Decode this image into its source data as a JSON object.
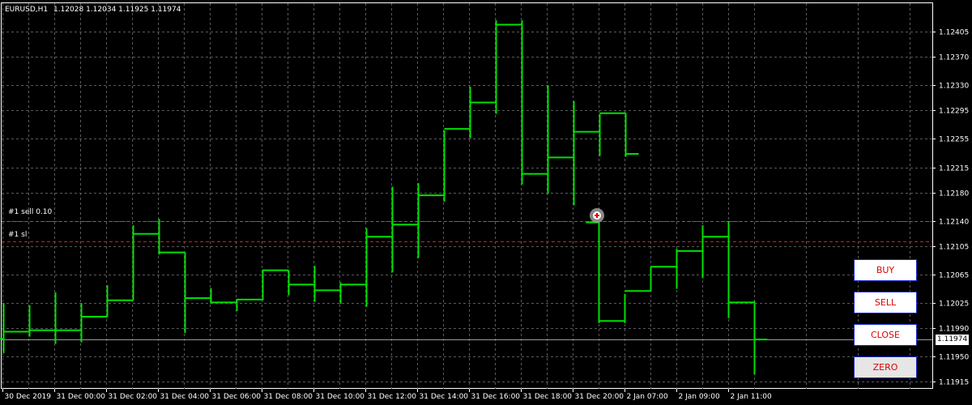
{
  "header": {
    "symbol": "EURUSD,H1",
    "ohlc": "1.12028 1.12034 1.11925 1.11974"
  },
  "order_lines": {
    "sell_label": "#1 sell 0.10",
    "sl_label": "#1 sl",
    "sell_color": "#00b000",
    "sl_color": "#d02020"
  },
  "current_price": "1.11974",
  "buttons": {
    "buy": "BUY",
    "sell": "SELL",
    "close": "CLOSE",
    "zero": "ZERO"
  },
  "colors": {
    "background": "#000000",
    "grid": "#5a5a5a",
    "bars": "#00e000",
    "axis_text": "#ffffff",
    "button_text": "#e00000",
    "button_border": "#1a2bd0"
  },
  "chart_data": {
    "type": "ohlc",
    "price_ticks": [
      "1.12405",
      "1.12370",
      "1.12330",
      "1.12295",
      "1.12255",
      "1.12215",
      "1.12180",
      "1.12140",
      "1.12105",
      "1.12065",
      "1.12025",
      "1.11990",
      "1.11950",
      "1.11915"
    ],
    "time_ticks": [
      "30 Dec 2019",
      "31 Dec 00:00",
      "31 Dec 02:00",
      "31 Dec 04:00",
      "31 Dec 06:00",
      "31 Dec 08:00",
      "31 Dec 10:00",
      "31 Dec 12:00",
      "31 Dec 14:00",
      "31 Dec 16:00",
      "31 Dec 18:00",
      "31 Dec 20:00",
      "2 Jan 07:00",
      "2 Jan 09:00",
      "2 Jan 11:00"
    ],
    "ylim": [
      1.11905,
      1.12445
    ],
    "sell_level": 1.1214,
    "sl_level": 1.12111,
    "bars": [
      [
        1.11975,
        1.12025,
        1.11955,
        1.11985
      ],
      [
        1.11985,
        1.12022,
        1.11978,
        1.11987
      ],
      [
        1.11987,
        1.1204,
        1.11968,
        1.11987
      ],
      [
        1.11987,
        1.12025,
        1.1197,
        1.12006
      ],
      [
        1.12006,
        1.1205,
        1.12006,
        1.12029
      ],
      [
        1.12029,
        1.12134,
        1.12029,
        1.12122
      ],
      [
        1.12122,
        1.12143,
        1.12093,
        1.12096
      ],
      [
        1.12096,
        1.12096,
        1.11983,
        1.12032
      ],
      [
        1.12032,
        1.12046,
        1.12024,
        1.12026
      ],
      [
        1.12026,
        1.12031,
        1.12014,
        1.1203
      ],
      [
        1.1203,
        1.12072,
        1.12029,
        1.12071
      ],
      [
        1.12071,
        1.12071,
        1.12036,
        1.12051
      ],
      [
        1.12051,
        1.12077,
        1.12027,
        1.12043
      ],
      [
        1.12043,
        1.12054,
        1.12024,
        1.12051
      ],
      [
        1.12051,
        1.1213,
        1.1202,
        1.12118
      ],
      [
        1.12118,
        1.12188,
        1.12068,
        1.12135
      ],
      [
        1.12135,
        1.12193,
        1.12088,
        1.12176
      ],
      [
        1.12176,
        1.12267,
        1.12167,
        1.12269
      ],
      [
        1.12269,
        1.12328,
        1.12256,
        1.12306
      ],
      [
        1.12306,
        1.12421,
        1.1229,
        1.12415
      ],
      [
        1.12415,
        1.12421,
        1.12191,
        1.12206
      ],
      [
        1.12206,
        1.1233,
        1.12178,
        1.12229
      ],
      [
        1.12229,
        1.12308,
        1.12162,
        1.12265
      ],
      [
        1.12265,
        1.1229,
        1.12231,
        1.12291
      ],
      [
        1.12291,
        1.12291,
        1.1223,
        1.12234
      ],
      [
        1.12138,
        1.12138,
        1.11997,
        1.12
      ],
      [
        1.12,
        1.12038,
        1.11997,
        1.12042
      ],
      [
        1.12042,
        1.12076,
        1.12042,
        1.12076
      ],
      [
        1.12076,
        1.12101,
        1.12045,
        1.12098
      ],
      [
        1.12098,
        1.12134,
        1.1206,
        1.12118
      ],
      [
        1.12118,
        1.1214,
        1.12004,
        1.12026
      ],
      [
        1.12026,
        1.12028,
        1.11925,
        1.11974
      ]
    ]
  }
}
